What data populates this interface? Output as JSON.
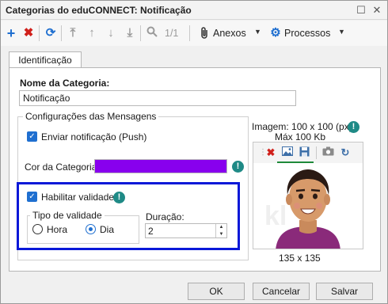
{
  "window": {
    "title": "Categorias do eduCONNECT: Notificação"
  },
  "toolbar": {
    "page_counter": "1/1",
    "anexos_label": "Anexos",
    "processos_label": "Processos"
  },
  "tabs": [
    {
      "label": "Identificação",
      "active": true
    }
  ],
  "form": {
    "nome_label": "Nome da Categoria:",
    "nome_value": "Notificação",
    "config_group_label": "Configurações das Mensagens",
    "push_label": "Enviar notificação (Push)",
    "push_checked": true,
    "cor_label": "Cor da Categoria:",
    "cor_value": "#8800ee",
    "habilitar_label": "Habilitar validade",
    "habilitar_checked": true,
    "tipo_group_label": "Tipo de validade",
    "hora_label": "Hora",
    "dia_label": "Dia",
    "selected_tipo": "Dia",
    "duracao_label": "Duração:",
    "duracao_value": "2",
    "image_hint_line1": "Imagem: 100 x 100 (px),",
    "image_hint_line2": "Máx 100 Kb",
    "image_size_caption": "135 x 135"
  },
  "buttons": {
    "ok": "OK",
    "cancelar": "Cancelar",
    "salvar": "Salvar"
  },
  "colors": {
    "accent": "#1f6fd0",
    "highlight": "#0a18d8",
    "info": "#1f8a86",
    "category_color": "#8800ee"
  }
}
